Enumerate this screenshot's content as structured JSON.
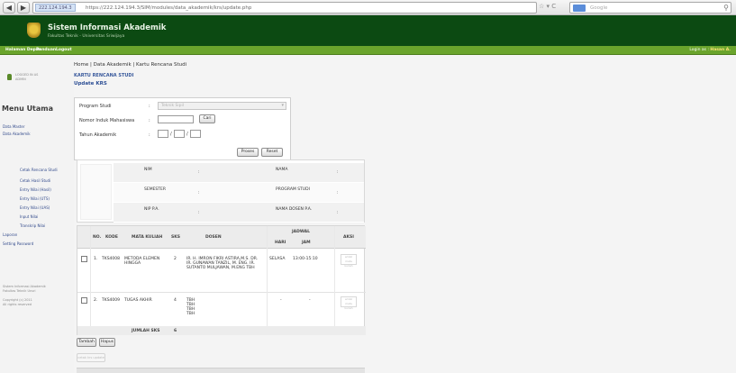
{
  "browser": {
    "site_id": "222.124.194.3",
    "url": "https://222.124.194.3/SIM/modules/data_akademik/krs/update.php",
    "search_placeholder": "Google"
  },
  "header": {
    "title": "Sistem Informasi Akademik",
    "subtitle": "Fakultas Teknik - Universitas Sriwijaya"
  },
  "topmenu": {
    "items": [
      "Halaman Depan",
      "Panduan",
      "Logout"
    ],
    "login_label": "Login as :",
    "login_user": "Hasan A.",
    "accent": "#6aa42c"
  },
  "sidebar": {
    "user_line1": "LOGGED IN AS",
    "user_line2": "ADMIN",
    "menu_title": "Menu Utama",
    "links": [
      "Data Master",
      "Data Akademik"
    ],
    "sub_links": [
      "Cetak Rencana Studi",
      "Cetak Hasil Studi",
      "Entry Nilai (Hasil)",
      "Entry Nilai (UTS)",
      "Entry Nilai (UAS)",
      "Input Nilai",
      "Transkrip Nilai"
    ],
    "links2": [
      "Laporan",
      "Setting Password"
    ],
    "footer_line1": "Sistem Informasi Akademik",
    "footer_line2": "Fakultas Teknik Unsri",
    "footer_line3": "Copyright (c) 2011",
    "footer_line4": "All rights reserved"
  },
  "page": {
    "breadcrumb": "Home | Data Akademik | Kartu Rencana Studi",
    "heading": "KARTU RENCANA STUDI",
    "subheading": "Update KRS"
  },
  "filter": {
    "label_prodi": "Program Studi",
    "prodi_value": "Teknik Sipil",
    "label_nim": "Nomor Induk Mahasiswa",
    "btn_cari": "Cari",
    "label_tahun": "Tahun Akademik",
    "slash": "/",
    "btn_proses": "Proses",
    "btn_reset": "Reset",
    "colon": ":"
  },
  "info": {
    "nim_label": "NIM",
    "nama_label": "NAMA",
    "semester_label": "SEMESTER",
    "prodi_label": "PROGRAM STUDI",
    "ipk_label": "NIP P.A.",
    "dosen_label": "NAMA DOSEN P.A.",
    "colon": ":"
  },
  "table": {
    "headers": {
      "no": "NO.",
      "kode": "KODE",
      "mk": "MATA KULIAH",
      "sks": "SKS",
      "dosen": "DOSEN",
      "jadwal": "JADWAL",
      "hari": "HARI",
      "jam": "JAM",
      "aksi": "AKSI"
    },
    "rows": [
      {
        "no": "1.",
        "kode": "TKS4008",
        "mk": "METODA ELEMEN HINGGA",
        "sks": "2",
        "dosen": "IR. H. IMRON FIKRI ASTIRA,M.S. DR. IR. GUNAWAN TANZIL, M. ENG. IR. SUTANTO MULJAWAN, M.ENG TBH",
        "hari": "SELASA",
        "jam": "13:00-15:10",
        "aksi": "ambil mata kuliah"
      },
      {
        "no": "2.",
        "kode": "TKS4009",
        "mk": "TUGAS AKHIR",
        "sks": "4",
        "dosen": "TBH TBH TBH TBH",
        "hari": "-",
        "jam": "-",
        "aksi": "ambil mata kuliah"
      }
    ],
    "total_label": "JUMLAH SKS",
    "total_value": "6"
  },
  "actions": {
    "tambah": "Tambah",
    "hapus": "Hapus",
    "cetak": "cetak krs update"
  }
}
